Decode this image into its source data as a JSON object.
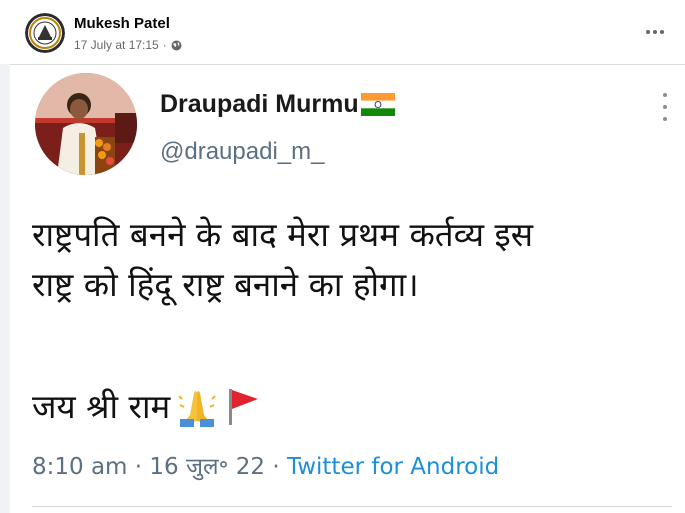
{
  "post": {
    "author": "Mukesh Patel",
    "date": "17 July at 17:15",
    "separator": "·",
    "privacy_icon": "globe-icon",
    "more_icon": "more-horizontal-icon"
  },
  "tweet": {
    "display_name": "Draupadi Murmu",
    "name_emoji": "india-flag-icon",
    "handle": "@draupadi_m_",
    "text_line1": "राष्ट्रपति बनने के बाद मेरा प्रथम कर्तव्य इस",
    "text_line2": "राष्ट्र को हिंदू राष्ट्र बनाने का होगा।",
    "text_line3": "जय श्री राम",
    "emojis": [
      "folded-hands-icon",
      "red-flag-icon"
    ],
    "time": "8:10 am",
    "dot": "·",
    "date": "16 जुल॰ 22",
    "dot2": "·",
    "source": "Twitter for Android"
  },
  "colors": {
    "fb_text": "#050505",
    "fb_meta": "#65676b",
    "tw_handle": "#5b7083",
    "tw_link": "#1d8fd8"
  }
}
